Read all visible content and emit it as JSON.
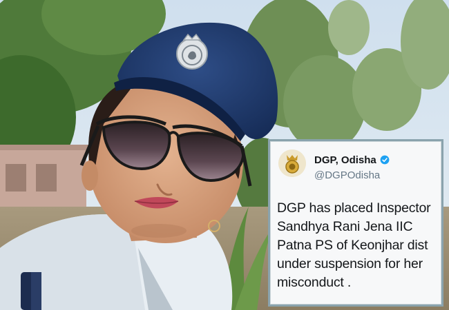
{
  "tweet": {
    "display_name": "DGP, Odisha",
    "handle": "@DGPOdisha",
    "verified": true,
    "text_lines": [
      "DGP has placed Inspector",
      "Sandhya Rani Jena IIC",
      "Patna PS of Keonjhar dist",
      "under suspension for her",
      "misconduct ."
    ]
  },
  "colors": {
    "verified_blue": "#1da1f2",
    "beret_blue": "#1f3a6d",
    "sky": "#d8e4ee",
    "foliage": "#3f6b2e"
  },
  "icons": {
    "avatar": "odisha-police-emblem-icon",
    "verified": "verified-badge-icon",
    "badge": "police-cap-badge-icon"
  }
}
